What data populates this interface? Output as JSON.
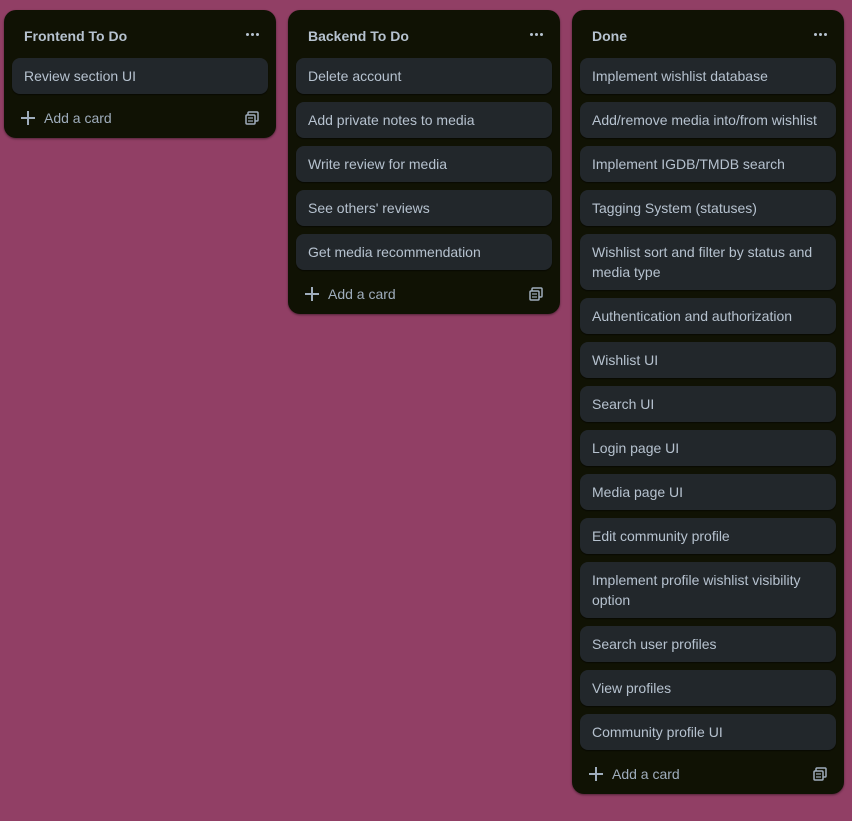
{
  "colors": {
    "board_background": "#913f65",
    "list_background": "#101204",
    "card_background": "#22272b",
    "text": "#b6c2cf"
  },
  "lists": [
    {
      "title": "Frontend To Do",
      "cards": [
        "Review section UI"
      ],
      "add_card_label": "Add a card"
    },
    {
      "title": "Backend To Do",
      "cards": [
        "Delete account",
        "Add private notes to media",
        "Write review for media",
        "See others' reviews",
        "Get media recommendation"
      ],
      "add_card_label": "Add a card"
    },
    {
      "title": "Done",
      "cards": [
        "Implement wishlist database",
        "Add/remove media into/from wishlist",
        "Implement IGDB/TMDB search",
        "Tagging System (statuses)",
        "Wishlist sort and filter by status and media type",
        "Authentication and authorization",
        "Wishlist UI",
        "Search UI",
        "Login page UI",
        "Media page UI",
        "Edit community profile",
        "Implement profile wishlist visibility option",
        "Search user profiles",
        "View profiles",
        "Community profile UI"
      ],
      "add_card_label": "Add a card"
    }
  ],
  "icons": {
    "list_menu": "more-horizontal-icon",
    "add_card": "plus-icon",
    "create_from_template": "template-icon"
  }
}
